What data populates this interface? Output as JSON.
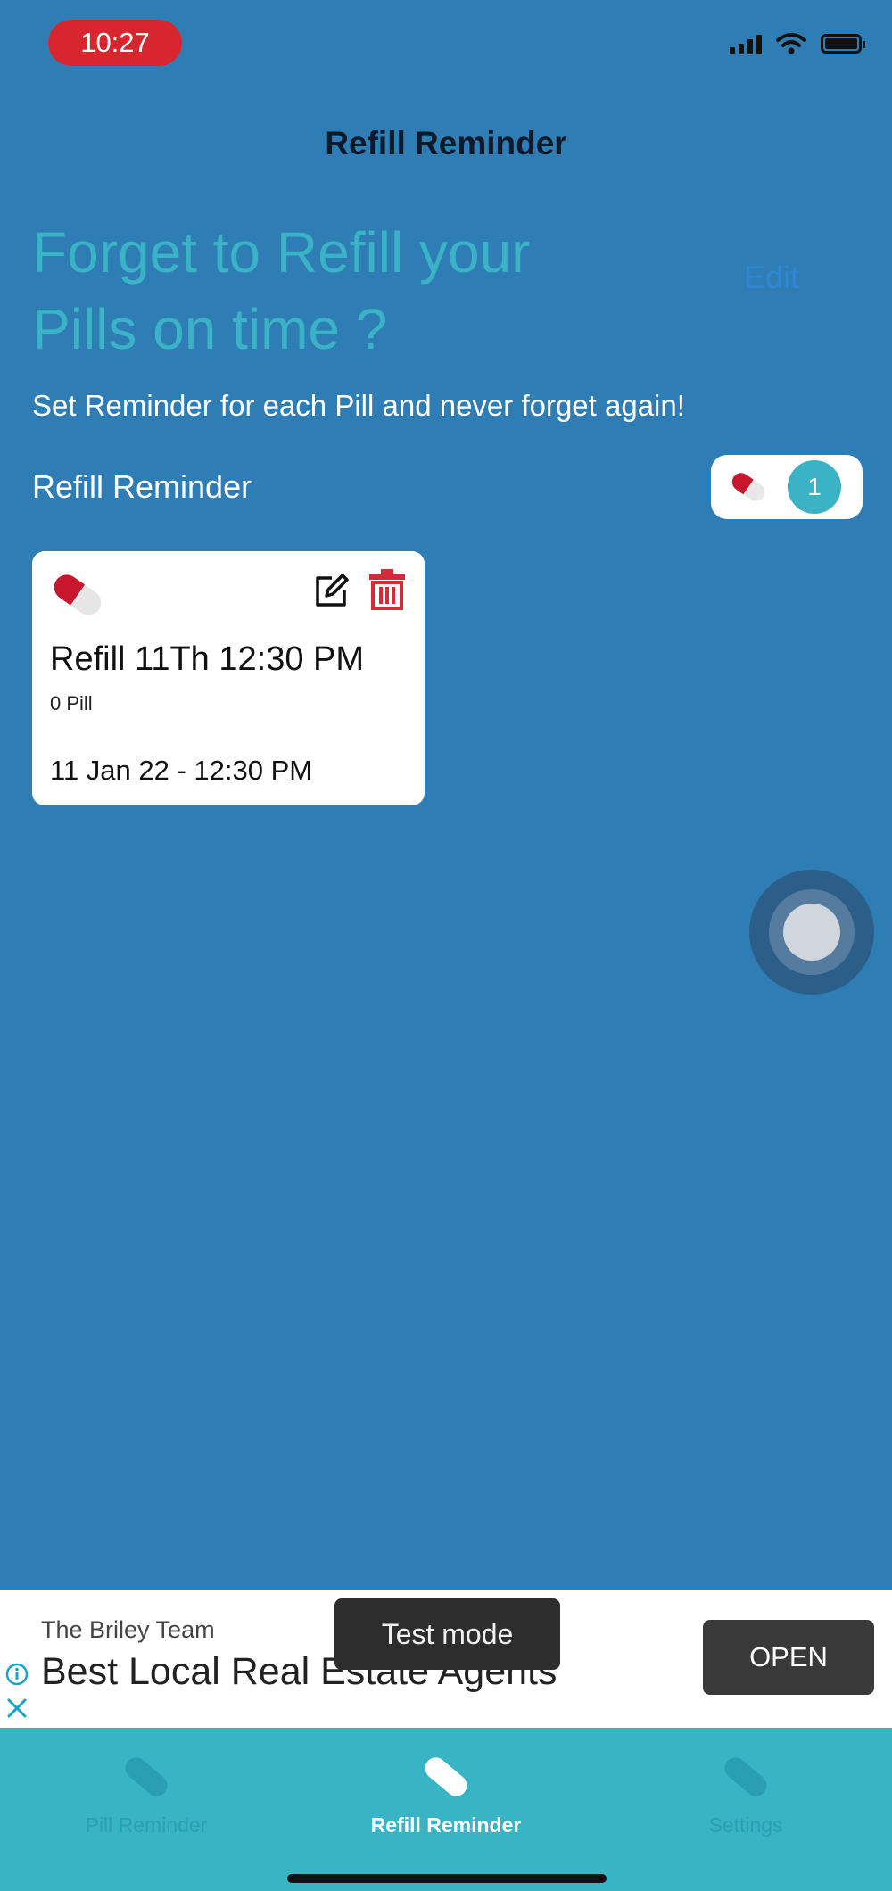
{
  "status_bar": {
    "time": "10:27",
    "icons": [
      "signal-icon",
      "wifi-icon",
      "battery-icon"
    ]
  },
  "nav": {
    "title": "Refill Reminder"
  },
  "hero": {
    "headline": "Forget to Refill your Pills on time ?",
    "faint_text": "Edit",
    "subtitle": "Set Reminder for each Pill and never forget again!"
  },
  "section": {
    "label": "Refill Reminder",
    "count": "1"
  },
  "reminders": [
    {
      "title": "Refill 11Th 12:30 PM",
      "quantity": "0 Pill",
      "datetime": "11 Jan 22 - 12:30 PM"
    }
  ],
  "ad": {
    "advertiser": "The Briley Team",
    "headline": "Best Local Real Estate Agents",
    "test_label": "Test mode",
    "cta": "OPEN"
  },
  "tabs": [
    {
      "label": "Pill Reminder",
      "active": false
    },
    {
      "label": "Refill Reminder",
      "active": true
    },
    {
      "label": "Settings",
      "active": false
    }
  ],
  "colors": {
    "background": "#2f7db5",
    "accent_teal": "#38b4c4",
    "headline": "#3ab3c7",
    "status_time_bg": "#d8262f",
    "delete": "#d62a3b"
  }
}
